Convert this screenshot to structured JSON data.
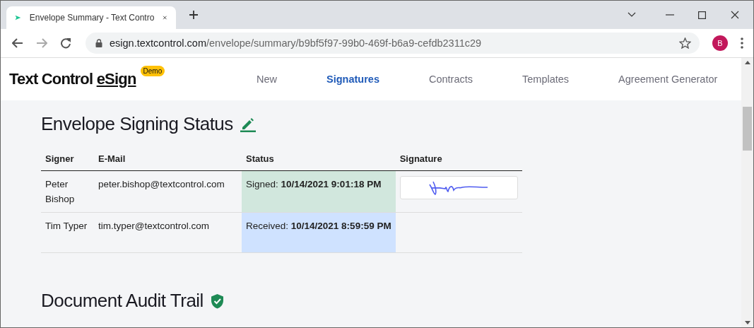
{
  "browser": {
    "tab_title": "Envelope Summary - Text Contro",
    "url_host": "esign.textcontrol.com",
    "url_path": "/envelope/summary/b9bf5f97-99b0-469f-b6a9-cefdb2311c29",
    "profile_initial": "B"
  },
  "header": {
    "brand": "Text Control ",
    "brand_link": "eSign",
    "badge": "Demo",
    "nav": [
      {
        "label": "New",
        "selected": false
      },
      {
        "label": "Signatures",
        "selected": true
      },
      {
        "label": "Contracts",
        "selected": false
      },
      {
        "label": "Templates",
        "selected": false
      },
      {
        "label": "Agreement Generator",
        "selected": false
      }
    ]
  },
  "signing_status": {
    "title": "Envelope Signing Status",
    "columns": [
      "Signer",
      "E-Mail",
      "Status",
      "Signature"
    ],
    "rows": [
      {
        "signer": "Peter Bishop",
        "email": "peter.bishop@textcontrol.com",
        "status": "Signed: **10/14/2021 9:01:18 PM**",
        "kind": "signed",
        "signature": true
      },
      {
        "signer": "Tim Typer",
        "email": "tim.typer@textcontrol.com",
        "status": "Received: **10/14/2021 8:59:59 PM**",
        "kind": "received",
        "signature": false
      }
    ]
  },
  "audit_trail": {
    "title": "Document Audit Trail"
  }
}
